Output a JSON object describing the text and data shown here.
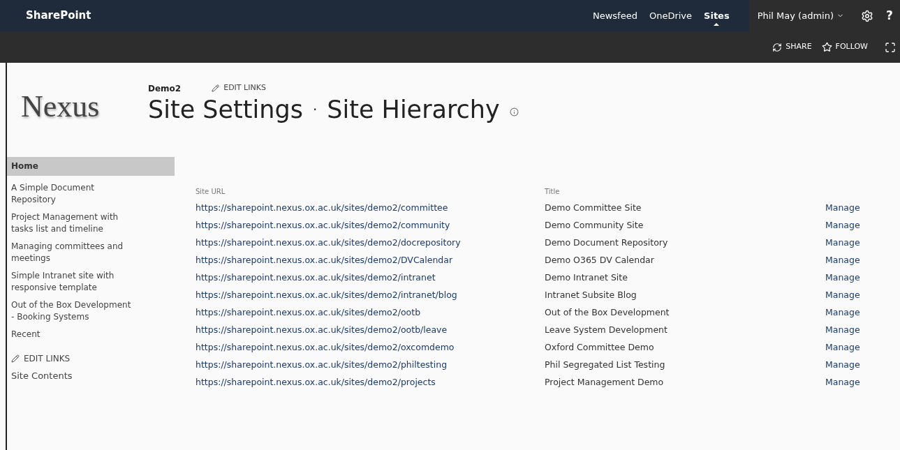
{
  "suite_bar": {
    "brand": "SharePoint",
    "nav": [
      {
        "label": "Newsfeed",
        "selected": false
      },
      {
        "label": "OneDrive",
        "selected": false
      },
      {
        "label": "Sites",
        "selected": true
      }
    ],
    "user": "Phil May (admin)",
    "help": "?"
  },
  "ribbon": {
    "actions": [
      "SHARE",
      "FOLLOW"
    ]
  },
  "header": {
    "logo": "Nexus",
    "site": "Demo2",
    "edit_links": "EDIT LINKS",
    "title": "Site Settings",
    "separator": "·",
    "subtitle": "Site Hierarchy"
  },
  "sidebar": {
    "items": [
      {
        "label": "Home",
        "selected": true
      },
      {
        "label": "A Simple Document Repository",
        "selected": false
      },
      {
        "label": "Project Management with tasks list and timeline",
        "selected": false
      },
      {
        "label": "Managing committees and meetings",
        "selected": false
      },
      {
        "label": "Simple Intranet site with responsive template",
        "selected": false
      },
      {
        "label": "Out of the Box Development - Booking Systems",
        "selected": false
      },
      {
        "label": "Recent",
        "selected": false
      }
    ],
    "edit_links": "EDIT LINKS",
    "site_contents": "Site Contents"
  },
  "table": {
    "columns": [
      "Site URL",
      "Title"
    ],
    "rows": [
      {
        "url": "https://sharepoint.nexus.ox.ac.uk/sites/demo2/committee",
        "title": "Demo Committee Site",
        "action": "Manage"
      },
      {
        "url": "https://sharepoint.nexus.ox.ac.uk/sites/demo2/community",
        "title": "Demo Community Site",
        "action": "Manage"
      },
      {
        "url": "https://sharepoint.nexus.ox.ac.uk/sites/demo2/docrepository",
        "title": "Demo Document Repository",
        "action": "Manage"
      },
      {
        "url": "https://sharepoint.nexus.ox.ac.uk/sites/demo2/DVCalendar",
        "title": "Demo O365 DV Calendar",
        "action": "Manage"
      },
      {
        "url": "https://sharepoint.nexus.ox.ac.uk/sites/demo2/intranet",
        "title": "Demo Intranet Site",
        "action": "Manage"
      },
      {
        "url": "https://sharepoint.nexus.ox.ac.uk/sites/demo2/intranet/blog",
        "title": "Intranet Subsite Blog",
        "action": "Manage"
      },
      {
        "url": "https://sharepoint.nexus.ox.ac.uk/sites/demo2/ootb",
        "title": "Out of the Box Development",
        "action": "Manage"
      },
      {
        "url": "https://sharepoint.nexus.ox.ac.uk/sites/demo2/ootb/leave",
        "title": "Leave System Development",
        "action": "Manage"
      },
      {
        "url": "https://sharepoint.nexus.ox.ac.uk/sites/demo2/oxcomdemo",
        "title": "Oxford Committee Demo",
        "action": "Manage"
      },
      {
        "url": "https://sharepoint.nexus.ox.ac.uk/sites/demo2/philtesting",
        "title": "Phil Segregated List Testing",
        "action": "Manage"
      },
      {
        "url": "https://sharepoint.nexus.ox.ac.uk/sites/demo2/projects",
        "title": "Project Management Demo",
        "action": "Manage"
      }
    ]
  }
}
